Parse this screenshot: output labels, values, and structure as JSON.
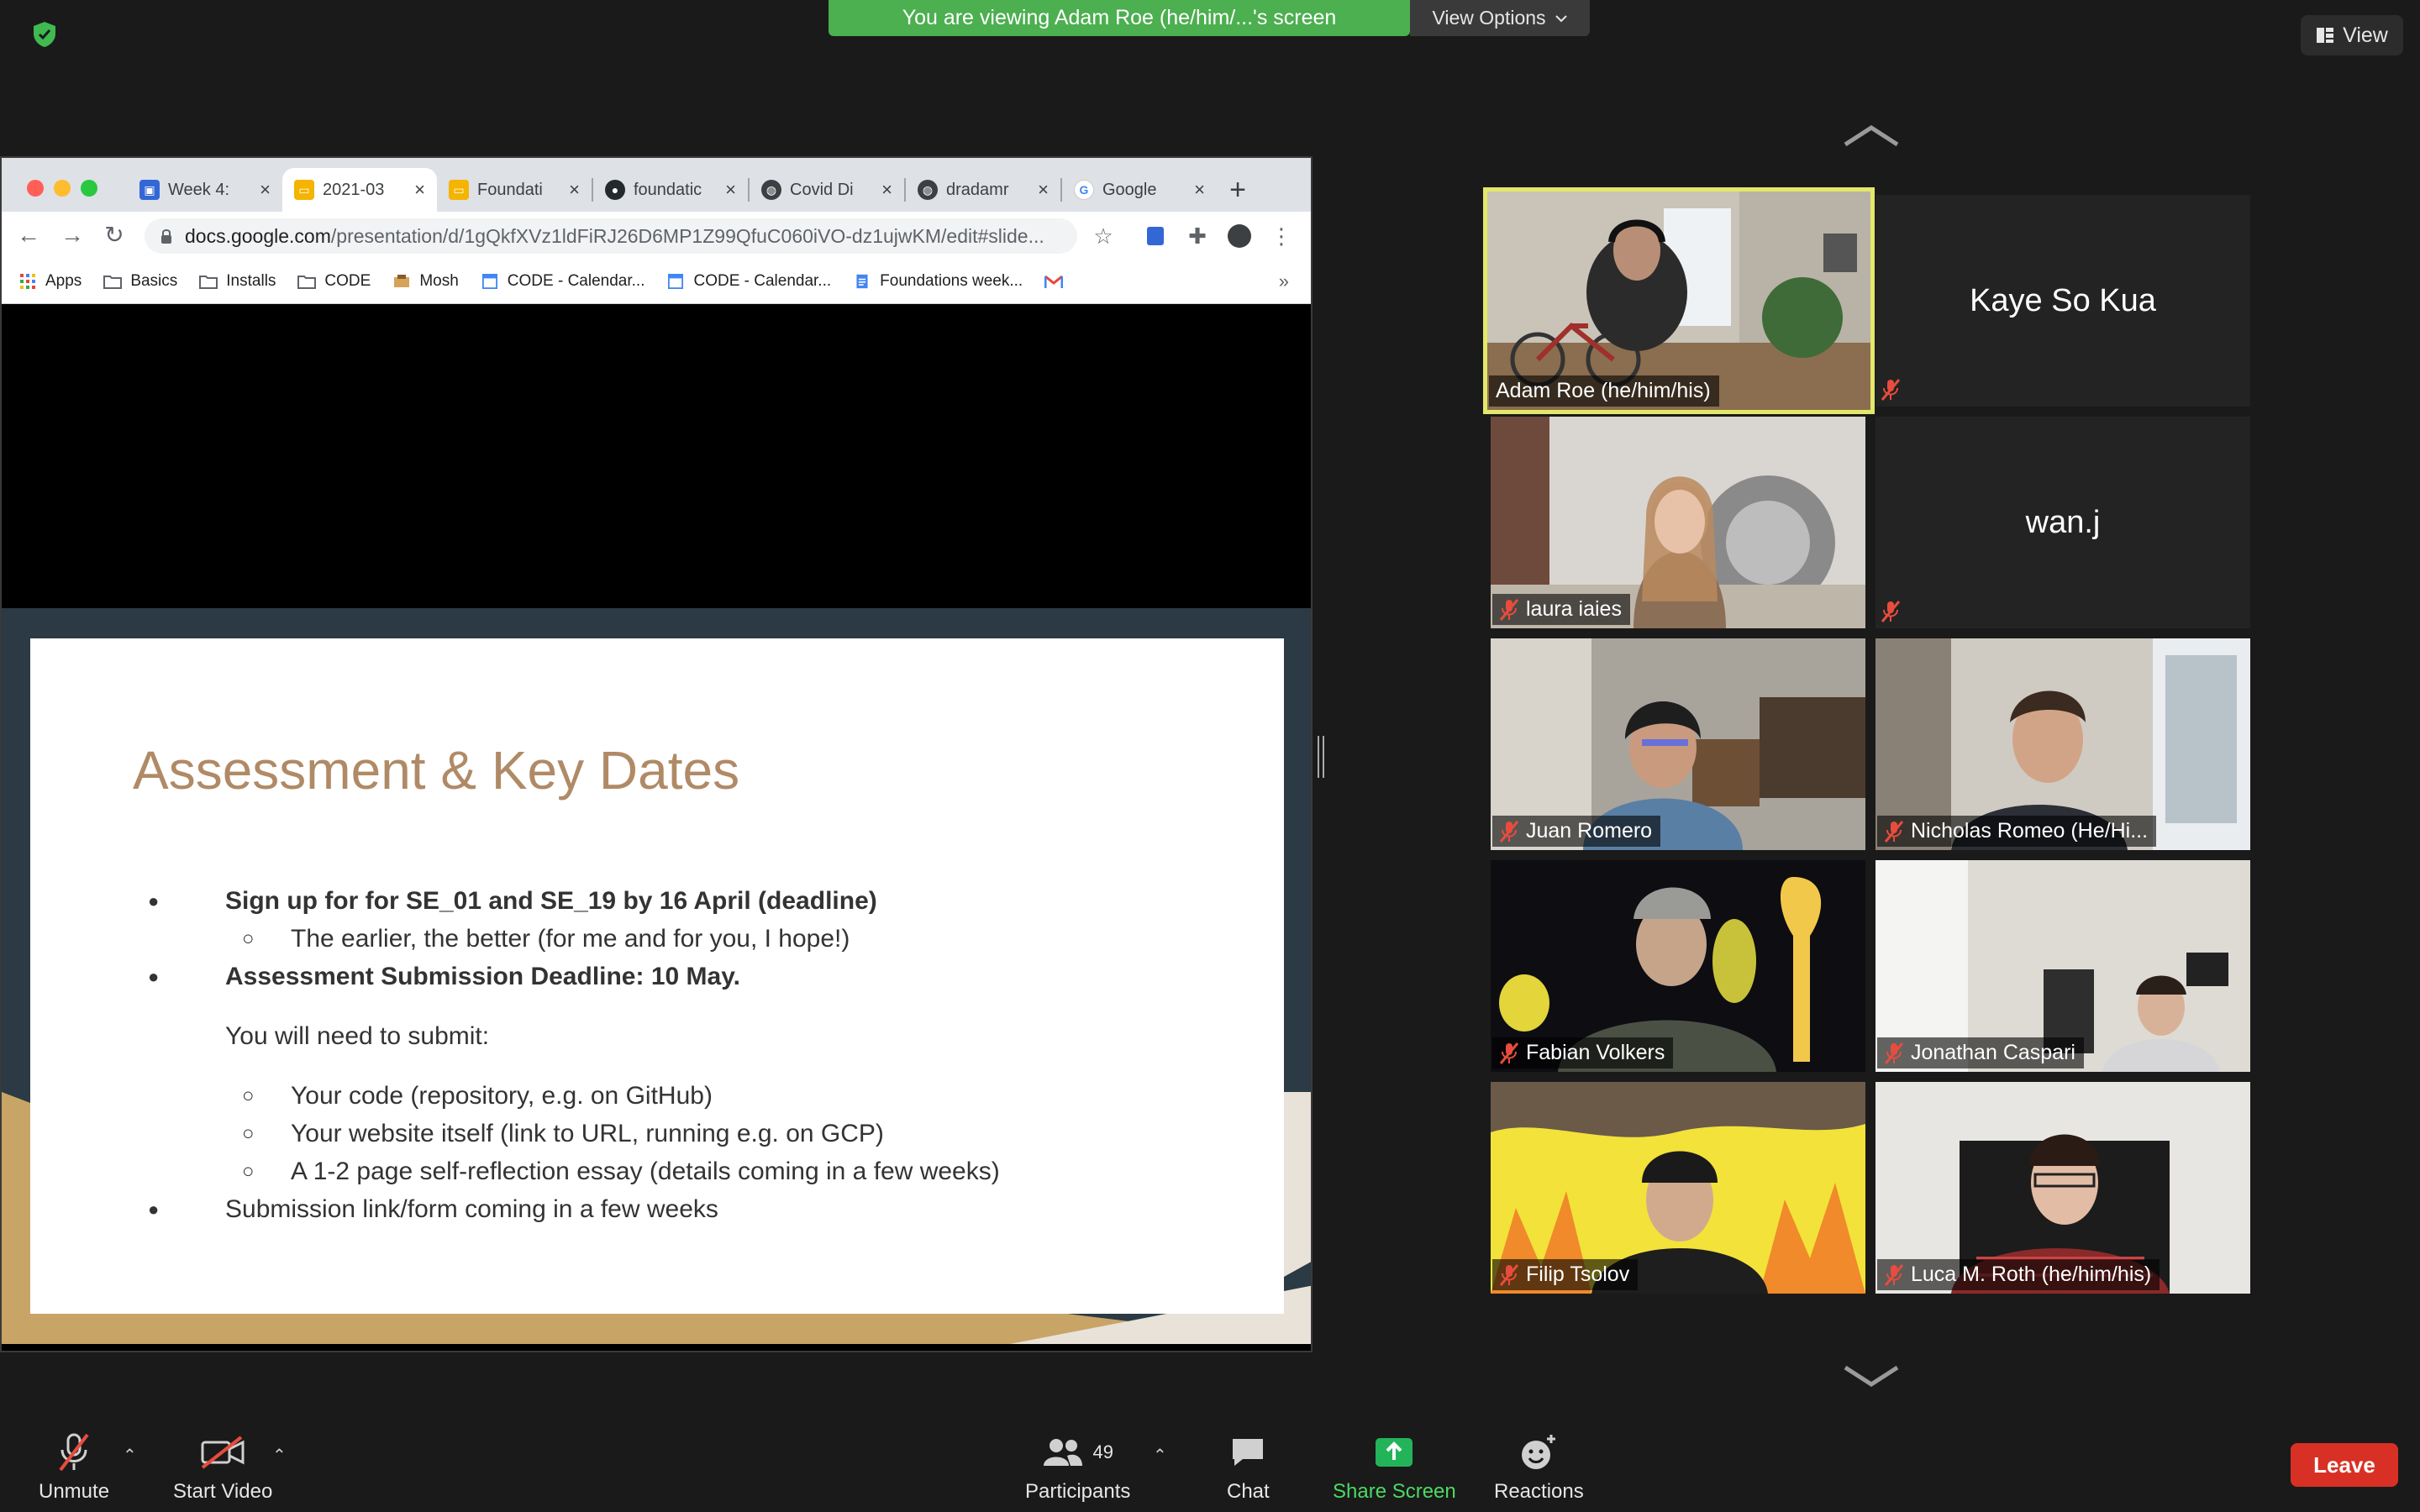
{
  "banner": {
    "viewing_text": "You are viewing Adam Roe (he/him/...'s screen",
    "view_options_label": "View Options"
  },
  "view_button_label": "View",
  "browser": {
    "tabs": [
      {
        "label": "Week 4:",
        "favicon": "google-classroom-icon"
      },
      {
        "label": "2021-03",
        "favicon": "google-slides-icon",
        "active": true
      },
      {
        "label": "Foundati",
        "favicon": "google-slides-icon"
      },
      {
        "label": "foundatic",
        "favicon": "github-icon"
      },
      {
        "label": "Covid Di",
        "favicon": "globe-icon"
      },
      {
        "label": "dradamr",
        "favicon": "globe-icon"
      },
      {
        "label": "Google",
        "favicon": "google-icon"
      }
    ],
    "url_host": "docs.google.com",
    "url_path": "/presentation/d/1gQkfXVz1ldFiRJ26D6MP1Z99QfuC060iVO-dz1ujwKM/edit#slide...",
    "bookmarks": [
      {
        "label": "Apps",
        "icon": "apps-grid-icon"
      },
      {
        "label": "Basics",
        "icon": "folder-icon"
      },
      {
        "label": "Installs",
        "icon": "folder-icon"
      },
      {
        "label": "CODE",
        "icon": "folder-icon"
      },
      {
        "label": "Mosh",
        "icon": "mosh-icon"
      },
      {
        "label": "CODE - Calendar...",
        "icon": "calendar-icon"
      },
      {
        "label": "CODE - Calendar...",
        "icon": "calendar-icon"
      },
      {
        "label": "Foundations week...",
        "icon": "docs-icon"
      },
      {
        "label": "",
        "icon": "gmail-icon"
      }
    ],
    "bookmarks_more": "»"
  },
  "slide": {
    "title": "Assessment & Key Dates",
    "b1": "Sign up for for SE_01 and SE_19 by 16 April (deadline)",
    "b1_sub": "The earlier, the better (for me and for you, I hope!)",
    "b2": "Assessment Submission Deadline: 10 May.",
    "submit_intro": "You will need to submit:",
    "submit_items": [
      "Your code (repository, e.g. on GitHub)",
      "Your website itself (link to URL, running e.g. on GCP)",
      "A 1-2 page self-reflection essay (details coming in a few weeks)"
    ],
    "b3": "Submission link/form coming in a few weeks"
  },
  "participants": [
    {
      "name": "Adam Roe (he/him/his)",
      "video": true,
      "muted": false,
      "active_speaker": true
    },
    {
      "name": "Kaye So Kua",
      "video": false,
      "muted": true
    },
    {
      "name": "laura iaies",
      "video": true,
      "muted": true
    },
    {
      "name": "wan.j",
      "video": false,
      "muted": true
    },
    {
      "name": "Juan Romero",
      "video": true,
      "muted": true
    },
    {
      "name": "Nicholas Romeo (He/Hi...",
      "video": true,
      "muted": true
    },
    {
      "name": "Fabian Volkers",
      "video": true,
      "muted": true
    },
    {
      "name": "Jonathan Caspari",
      "video": true,
      "muted": true
    },
    {
      "name": "Filip Tsolov",
      "video": true,
      "muted": true
    },
    {
      "name": "Luca M. Roth (he/him/his)",
      "video": true,
      "muted": true
    }
  ],
  "controls": {
    "unmute": "Unmute",
    "start_video": "Start Video",
    "participants": "Participants",
    "participants_count": "49",
    "chat": "Chat",
    "share_screen": "Share Screen",
    "reactions": "Reactions",
    "leave": "Leave"
  },
  "colors": {
    "banner_green": "#4caf50",
    "active_speaker": "#e4e86a",
    "leave_red": "#d93025",
    "share_green": "#4cd964",
    "slide_title": "#b08a66"
  }
}
